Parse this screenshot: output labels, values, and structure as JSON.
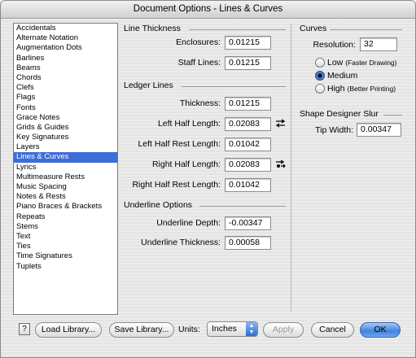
{
  "window": {
    "title": "Document Options - Lines & Curves"
  },
  "sidebar": {
    "items": [
      {
        "label": "Accidentals"
      },
      {
        "label": "Alternate Notation"
      },
      {
        "label": "Augmentation Dots"
      },
      {
        "label": "Barlines"
      },
      {
        "label": "Beams"
      },
      {
        "label": "Chords"
      },
      {
        "label": "Clefs"
      },
      {
        "label": "Flags"
      },
      {
        "label": "Fonts"
      },
      {
        "label": "Grace Notes"
      },
      {
        "label": "Grids & Guides"
      },
      {
        "label": "Key Signatures"
      },
      {
        "label": "Layers"
      },
      {
        "label": "Lines & Curves",
        "selected": true
      },
      {
        "label": "Lyrics"
      },
      {
        "label": "Multimeasure Rests"
      },
      {
        "label": "Music Spacing"
      },
      {
        "label": "Notes & Rests"
      },
      {
        "label": "Piano Braces & Brackets"
      },
      {
        "label": "Repeats"
      },
      {
        "label": "Stems"
      },
      {
        "label": "Text"
      },
      {
        "label": "Ties"
      },
      {
        "label": "Time Signatures"
      },
      {
        "label": "Tuplets"
      }
    ]
  },
  "line_thickness": {
    "title": "Line Thickness",
    "enclosures_label": "Enclosures:",
    "enclosures_value": "0.01215",
    "staff_lines_label": "Staff Lines:",
    "staff_lines_value": "0.01215"
  },
  "ledger_lines": {
    "title": "Ledger Lines",
    "thickness_label": "Thickness:",
    "thickness_value": "0.01215",
    "left_half_label": "Left Half Length:",
    "left_half_value": "0.02083",
    "left_half_rest_label": "Left Half Rest Length:",
    "left_half_rest_value": "0.01042",
    "right_half_label": "Right Half Length:",
    "right_half_value": "0.02083",
    "right_half_rest_label": "Right Half Rest Length:",
    "right_half_rest_value": "0.01042"
  },
  "underline": {
    "title": "Underline Options",
    "depth_label": "Underline Depth:",
    "depth_value": "-0.00347",
    "thickness_label": "Underline Thickness:",
    "thickness_value": "0.00058"
  },
  "curves": {
    "title": "Curves",
    "resolution_label": "Resolution:",
    "resolution_value": "32",
    "low_label": "Low",
    "low_note": "(Faster Drawing)",
    "medium_label": "Medium",
    "high_label": "High",
    "high_note": "(Better Printing)",
    "selected": "Medium"
  },
  "slur": {
    "title": "Shape Designer Slur",
    "tip_width_label": "Tip Width:",
    "tip_width_value": "0.00347"
  },
  "footer": {
    "help_label": "?",
    "load_library": "Load Library...",
    "save_library": "Save Library...",
    "units_label": "Units:",
    "units_value": "Inches",
    "apply": "Apply",
    "cancel": "Cancel",
    "ok": "OK"
  },
  "icons": {
    "left_half_link": "link-arrows-icon",
    "right_half_link": "link-arrows-icon"
  }
}
